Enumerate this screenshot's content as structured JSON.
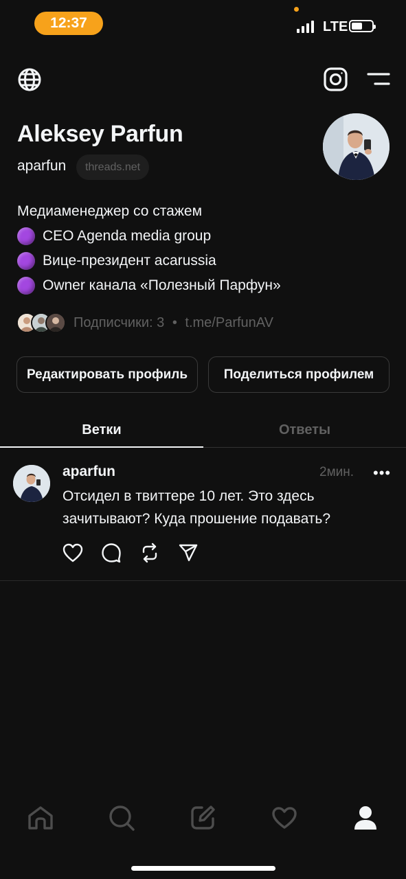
{
  "status_bar": {
    "time": "12:37",
    "network": "LTE"
  },
  "profile": {
    "name": "Aleksey Parfun",
    "handle": "aparfun",
    "domain": "threads.net",
    "bio": [
      "Медиаменеджер со стажем",
      "CEO Agenda media group",
      "Вице-президент acarussia",
      "Owner канала «Полезный Парфун»"
    ],
    "followers_text": "Подписчики: 3",
    "separator": "•",
    "link": "t.me/ParfunAV"
  },
  "buttons": {
    "edit": "Редактировать профиль",
    "share": "Поделиться профилем"
  },
  "tabs": [
    {
      "label": "Ветки",
      "active": true
    },
    {
      "label": "Ответы",
      "active": false
    }
  ],
  "post": {
    "username": "aparfun",
    "time": "2мин.",
    "more": "•••",
    "text": "Отсидел в твиттере 10 лет. Это здесь зачитывают? Куда прошение подавать?"
  },
  "icons": {
    "header": [
      "globe-icon",
      "instagram-icon",
      "menu-icon"
    ],
    "post_actions": [
      "heart-icon",
      "comment-icon",
      "repost-icon",
      "share-icon"
    ],
    "nav": [
      "home-icon",
      "search-icon",
      "compose-icon",
      "activity-icon",
      "profile-icon"
    ]
  },
  "colors": {
    "accent": "#f7a21b",
    "bullet": "#a347e0",
    "background": "#101010",
    "muted": "#616161"
  }
}
